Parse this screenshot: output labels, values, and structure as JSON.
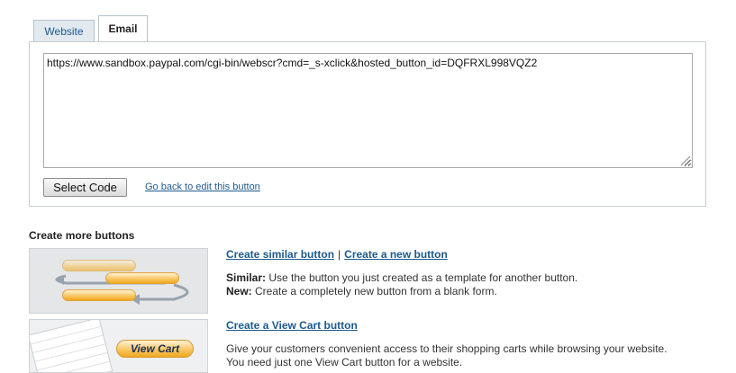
{
  "tabs": [
    {
      "label": "Website"
    },
    {
      "label": "Email"
    }
  ],
  "code": {
    "value": "https://www.sandbox.paypal.com/cgi-bin/webscr?cmd=_s-xclick&hosted_button_id=DQFRXL998VQZ2"
  },
  "actions": {
    "select_code": "Select Code",
    "back_link": "Go back to edit this button"
  },
  "more": {
    "title": "Create more buttons",
    "similar_link": "Create similar button",
    "separator": "|",
    "new_link": "Create a new button",
    "similar_term": "Similar:",
    "similar_desc": "Use the button you just created as a template for another button.",
    "new_term": "New:",
    "new_desc": "Create a completely new button from a blank form.",
    "viewcart_link": "Create a View Cart button",
    "viewcart_desc_1": "Give your customers convenient access to their shopping carts while browsing your website.",
    "viewcart_desc_2": "You need just one View Cart button for a website.",
    "viewcart_thumb_label": "View Cart"
  }
}
